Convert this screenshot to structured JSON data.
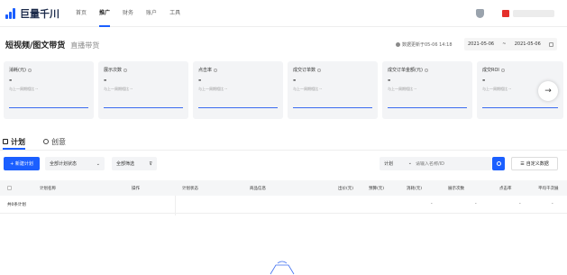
{
  "brand": {
    "name": "巨量千川"
  },
  "nav": {
    "items": [
      "首页",
      "推广",
      "财务",
      "账户",
      "工具"
    ],
    "active_index": 1
  },
  "header": {
    "title": "短视频/图文带货",
    "subtitle": "直播带货"
  },
  "update": {
    "text": "数据更新于05-06 14:18"
  },
  "date_range": {
    "start": "2021-05-06",
    "sep": "~",
    "end": "2021-05-06"
  },
  "metrics": [
    {
      "label": "消耗(元)",
      "value": "-",
      "compare": "与上一周期相比 --"
    },
    {
      "label": "展示次数",
      "value": "-",
      "compare": "与上一周期相比 --"
    },
    {
      "label": "点击率",
      "value": "-",
      "compare": "与上一周期相比 --"
    },
    {
      "label": "成交订单数",
      "value": "-",
      "compare": "与上一周期相比 --"
    },
    {
      "label": "成交订单金额(元)",
      "value": "-",
      "compare": "与上一周期相比 --"
    },
    {
      "label": "成交ROI",
      "value": "-",
      "compare": "与上一周期相比 --"
    }
  ],
  "tabs": {
    "plan": "计划",
    "creative": "创意"
  },
  "toolbar": {
    "new_plan": "+ 新建计划",
    "status_filter": "全部计划状态",
    "all_filter": "全部筛选",
    "scope": "计划",
    "search_placeholder": "请输入名称/ID",
    "custom_columns": "自定义数据"
  },
  "table": {
    "headers": [
      "计划名称",
      "操作",
      "计划状态",
      "商品信息",
      "出价(元)",
      "预算(元)",
      "消耗(元)",
      "展示次数",
      "点击率",
      "平均千次展"
    ],
    "total_row": {
      "label": "共0条计划",
      "cells": [
        "-",
        "-",
        "-",
        "-"
      ]
    }
  }
}
